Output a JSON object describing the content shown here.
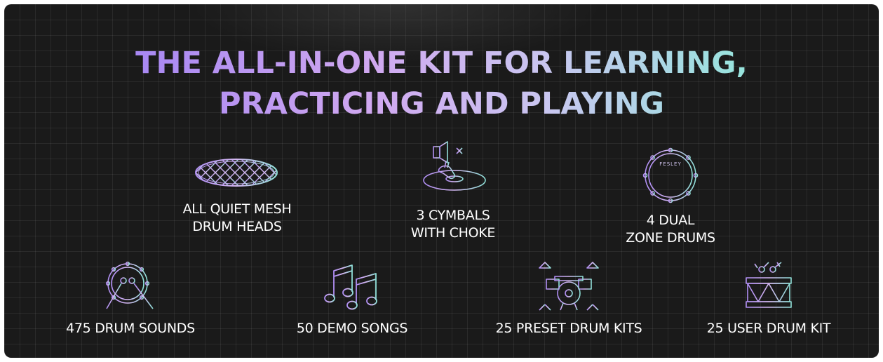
{
  "title": {
    "line1": "THE ALL-IN-ONE KIT FOR LEARNING,",
    "line2": "PRACTICING AND PLAYING"
  },
  "features_row1": [
    {
      "icon": "mesh-drum-head-icon",
      "label": "ALL QUIET MESH\nDRUM HEADS"
    },
    {
      "icon": "cymbal-choke-icon",
      "label": "3 CYMBALS\nWITH CHOKE"
    },
    {
      "icon": "dual-zone-drum-icon",
      "label": "4 DUAL\nZONE DRUMS",
      "logo_text": "FESLEY"
    }
  ],
  "features_row2": [
    {
      "icon": "drum-sticks-icon",
      "label": "475 DRUM SOUNDS"
    },
    {
      "icon": "music-notes-icon",
      "label": "50 DEMO SONGS"
    },
    {
      "icon": "drum-kit-icon",
      "label": "25 PRESET DRUM KITS"
    },
    {
      "icon": "snare-drum-icon",
      "label": "25 USER DRUM KIT"
    }
  ],
  "colors": {
    "background": "#1a1a1a",
    "gradient_start": "#a686f2",
    "gradient_mid": "#d0a8f0",
    "gradient_end": "#94e6dc",
    "label_text": "#ffffff"
  }
}
